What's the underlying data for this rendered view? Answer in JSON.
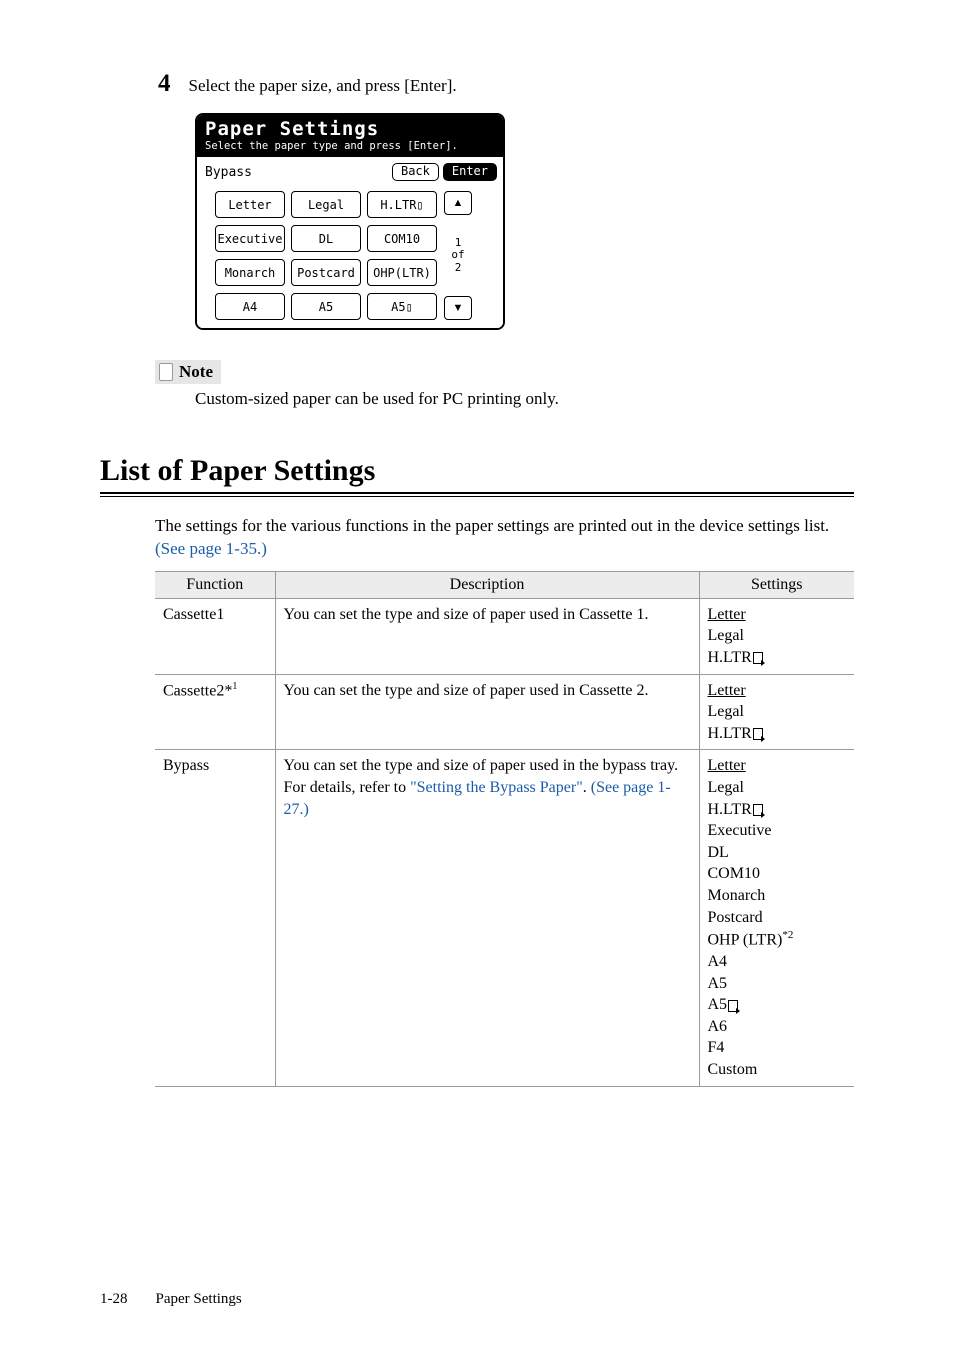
{
  "step": {
    "num": "4",
    "text": "Select the paper size, and press [Enter]."
  },
  "screen": {
    "title": "Paper Settings",
    "subtitle": "Select the paper type and press [Enter].",
    "sourceLabel": "Bypass",
    "backBtn": "Back",
    "enterBtn": "Enter",
    "sizes": [
      "Letter",
      "Legal",
      "H.LTR▯",
      "Executive",
      "DL",
      "COM10",
      "Monarch",
      "Postcard",
      "OHP(LTR)",
      "A4",
      "A5",
      "A5▯"
    ],
    "pageTop": "1",
    "pageOf": "of",
    "pageBottom": "2"
  },
  "note": {
    "label": "Note",
    "text": "Custom-sized paper can be used for PC printing only."
  },
  "section": {
    "heading": "List of Paper Settings",
    "intro1": "The settings for the various functions in the paper settings are printed out in the device settings list. ",
    "introLink": "(See page 1-35.)"
  },
  "tableHeaders": {
    "func": "Function",
    "desc": "Description",
    "settings": "Settings"
  },
  "rows": {
    "cassette1": {
      "func": "Cassette1",
      "desc": "You can set the type and size of paper used in Cassette 1.",
      "settingsUnderline": "Letter",
      "s2": "Legal",
      "s3": "H.LTR"
    },
    "cassette2": {
      "funcBase": "Cassette2*",
      "funcSup": "1",
      "desc": "You can set the type and size of paper used in Cassette 2.",
      "settingsUnderline": "Letter",
      "s2": "Legal",
      "s3": "H.LTR"
    },
    "bypass": {
      "func": "Bypass",
      "descStart": "You can set the type and size of paper used in the bypass tray. For details, refer to ",
      "descLink1": "\"Setting the Bypass Paper\"",
      "descMid": ". ",
      "descLink2": "(See page 1-27.)",
      "settingsUnderline": "Letter",
      "s2": "Legal",
      "s3": "H.LTR",
      "s4": "Executive",
      "s5": "DL",
      "s6": "COM10",
      "s7": "Monarch",
      "s8": "Postcard",
      "s9a": "OHP (LTR)",
      "s9sup": "*2",
      "s10": "A4",
      "s11": "A5",
      "s12": "A5",
      "s13": "A6",
      "s14": "F4",
      "s15": "Custom"
    }
  },
  "footer": {
    "page": "1-28",
    "section": "Paper Settings"
  }
}
